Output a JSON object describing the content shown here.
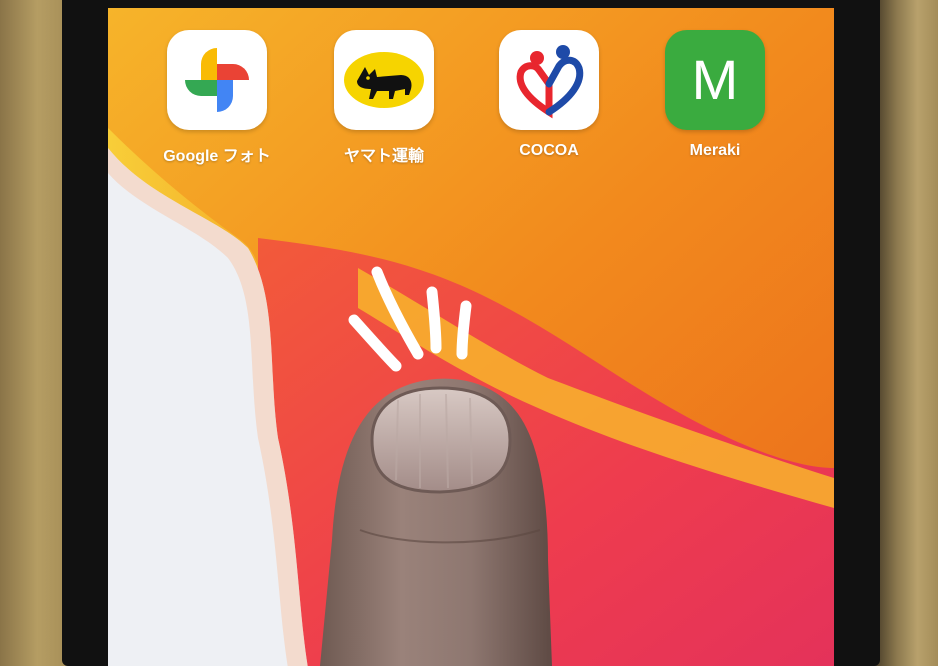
{
  "home_screen": {
    "apps": [
      {
        "label": "Google フォト",
        "icon": "pinwheel-icon"
      },
      {
        "label": "ヤマト運輸",
        "icon": "black-cat-icon"
      },
      {
        "label": "COCOA",
        "icon": "heart-figures-icon"
      },
      {
        "label": "Meraki",
        "icon": "letter-m-icon",
        "letter": "M"
      }
    ]
  },
  "colors": {
    "wallpaper_orange": "#f08a1e",
    "wallpaper_red": "#ef3f4c",
    "wallpaper_yellow": "#f7c531",
    "meraki_green": "#3aab3f"
  }
}
